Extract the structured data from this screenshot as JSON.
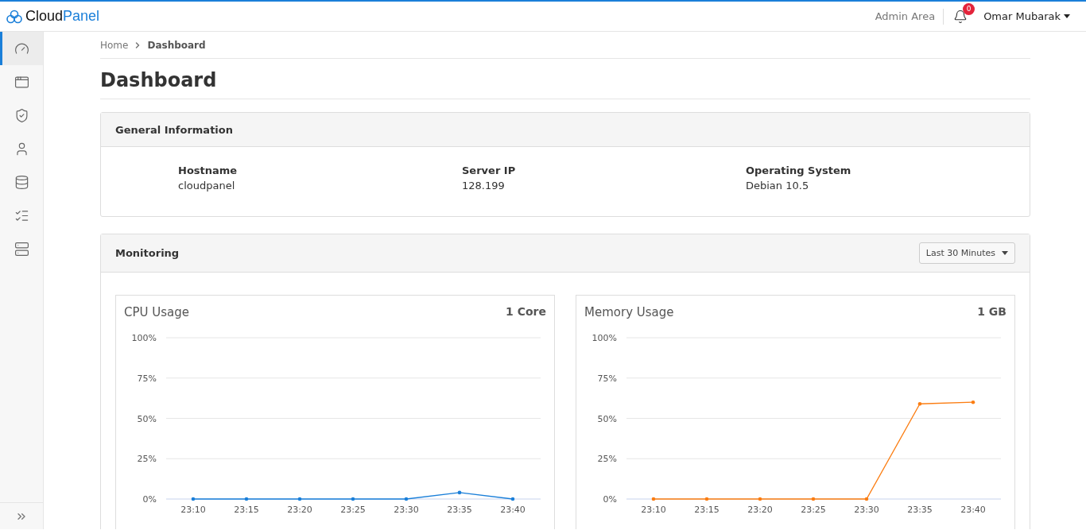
{
  "header": {
    "logo": {
      "primary": "Cloud",
      "accent": "Panel"
    },
    "admin_link": "Admin Area",
    "notifications": {
      "count": "0"
    },
    "user": "Omar Mubarak"
  },
  "sidebar": {
    "items": [
      {
        "selected": true
      },
      {
        "selected": false
      },
      {
        "selected": false
      },
      {
        "selected": false
      },
      {
        "selected": false
      },
      {
        "selected": false
      },
      {
        "selected": false
      }
    ]
  },
  "breadcrumb": [
    "Home",
    "Dashboard"
  ],
  "page_title": "Dashboard",
  "general_information": {
    "title": "General Information",
    "fields": [
      {
        "label": "Hostname",
        "value": "cloudpanel"
      },
      {
        "label": "Server IP",
        "value": "128.199"
      },
      {
        "label": "Operating System",
        "value": "Debian 10.5"
      }
    ]
  },
  "monitoring": {
    "title": "Monitoring",
    "range": "Last 30 Minutes",
    "charts": [
      {
        "title": "CPU Usage",
        "capacity": "1 Core",
        "chart_data": {
          "type": "line",
          "categories": [
            "23:10",
            "23:15",
            "23:20",
            "23:25",
            "23:30",
            "23:35",
            "23:40"
          ],
          "series": [
            {
              "color": "#1a7fd9",
              "values": [
                0,
                0,
                0,
                0,
                0,
                4,
                0
              ]
            }
          ],
          "grid": true,
          "ylim": [
            0,
            100
          ],
          "yticks": [
            {
              "value": 0,
              "label": "0%"
            },
            {
              "value": 25,
              "label": "25%"
            },
            {
              "value": 50,
              "label": "50%"
            },
            {
              "value": 75,
              "label": "75%"
            },
            {
              "value": 100,
              "label": "100%"
            }
          ]
        }
      },
      {
        "title": "Memory Usage",
        "capacity": "1 GB",
        "chart_data": {
          "type": "line",
          "categories": [
            "23:10",
            "23:15",
            "23:20",
            "23:25",
            "23:30",
            "23:35",
            "23:40"
          ],
          "series": [
            {
              "color": "#fb7d12",
              "values": [
                0,
                0,
                0,
                0,
                0,
                59,
                60
              ]
            }
          ],
          "grid": true,
          "ylim": [
            0,
            100
          ],
          "yticks": [
            {
              "value": 0,
              "label": "0%"
            },
            {
              "value": 25,
              "label": "25%"
            },
            {
              "value": 50,
              "label": "50%"
            },
            {
              "value": 75,
              "label": "75%"
            },
            {
              "value": 100,
              "label": "100%"
            }
          ]
        }
      }
    ]
  }
}
